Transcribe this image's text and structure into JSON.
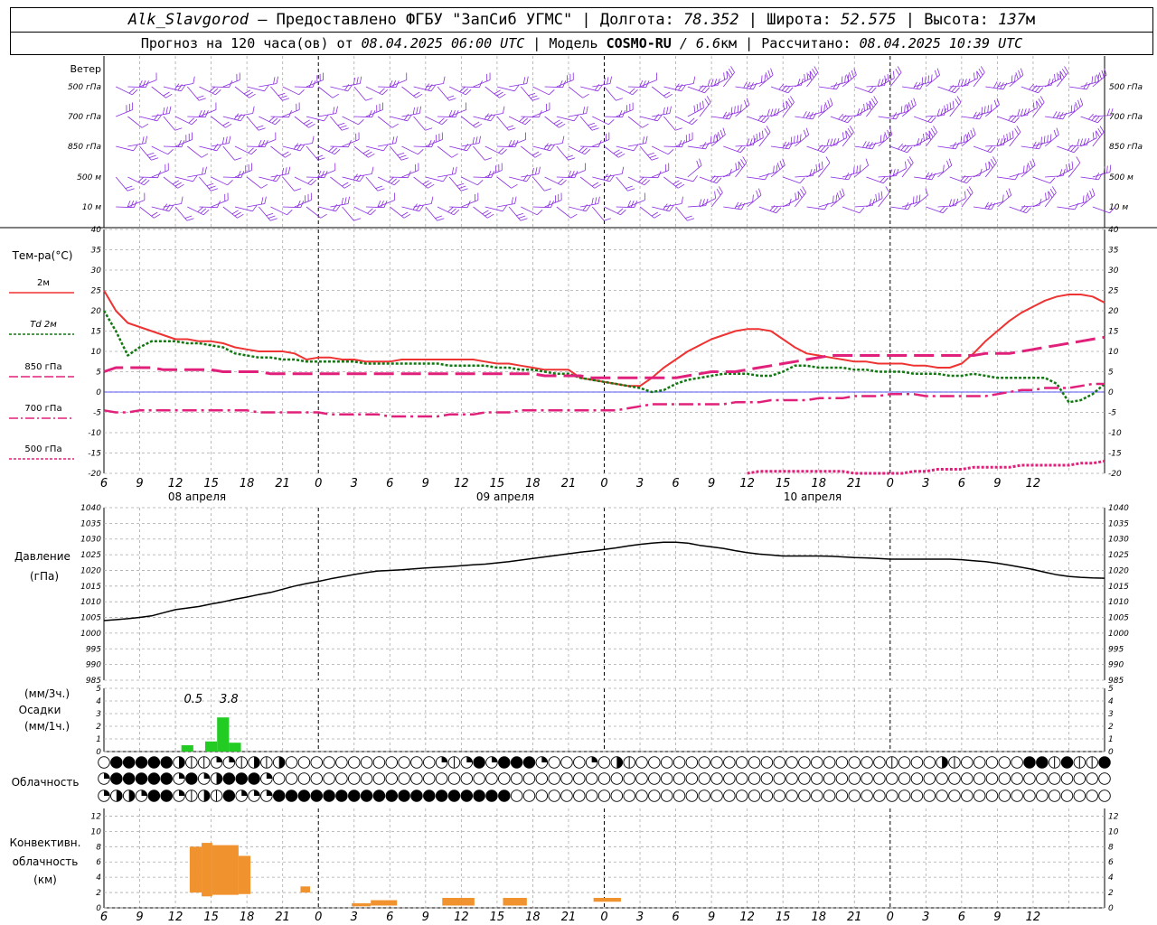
{
  "header": {
    "station": "Alk_Slavgorod",
    "provider": "— Предоставлено ФГБУ \"ЗапСиб УГМС\"",
    "lon_label": "Долгота:",
    "lon_value": "78.352",
    "lat_label": "Широта:",
    "lat_value": "52.575",
    "alt_label": "Высота:",
    "alt_value": "137",
    "alt_unit": "м",
    "forecast_label": "Прогноз на 120 часа(ов) от",
    "forecast_start": "08.04.2025 06:00 UTC",
    "model_label": "Модель",
    "model_name": "COSMO-RU",
    "model_res": "/ 6.6",
    "model_res_unit": "км",
    "computed_label": "Рассчитано:",
    "computed_value": "08.04.2025 10:39 UTC"
  },
  "colors": {
    "t2m": "#ee3333",
    "td2m": "#117711",
    "t850": "#e0207a",
    "t700": "#e0207a",
    "t500": "#e0207a",
    "wind": "#8a2be2",
    "precip": "#22cc22",
    "conv": "#f0922e",
    "pressure": "#000000",
    "zero_line": "#2222ee"
  },
  "chart_data": {
    "time_axis": {
      "hour_labels": [
        "6",
        "9",
        "12",
        "15",
        "18",
        "21",
        "0",
        "3",
        "6",
        "9",
        "12",
        "15",
        "18",
        "21",
        "0",
        "3",
        "6",
        "9",
        "12",
        "15",
        "18",
        "21",
        "0",
        "3",
        "6",
        "9",
        "12"
      ],
      "day_labels": [
        "08 апреля",
        "09 апреля",
        "10 апреля"
      ]
    },
    "wind": {
      "label": "Ветер",
      "levels": [
        "500 гПа",
        "700 гПа",
        "850 гПа",
        "500 м",
        "10 м"
      ]
    },
    "temperature": {
      "type": "line",
      "label": "Тем-ра(°C)",
      "ylim": [
        -20,
        40
      ],
      "ticks": [
        40,
        35,
        30,
        25,
        20,
        15,
        10,
        5,
        0,
        -5,
        -10,
        -15,
        -20
      ],
      "series": [
        {
          "name": "2м",
          "key": "t2m",
          "style": "solid",
          "values": [
            25,
            20,
            17,
            16,
            15,
            14,
            13,
            13,
            12.5,
            12.5,
            12,
            11,
            10.5,
            10,
            10,
            10,
            9.5,
            8,
            8.5,
            8.5,
            8,
            8,
            7.5,
            7.5,
            7.5,
            8,
            8,
            8,
            8,
            8,
            8,
            8,
            7.5,
            7,
            7,
            6.5,
            6,
            5.5,
            5.5,
            5.5,
            3.5,
            3,
            2.5,
            2,
            1.5,
            1.5,
            3.5,
            6,
            8,
            10,
            11.5,
            13,
            14,
            15,
            15.5,
            15.5,
            15,
            13,
            11,
            9.5,
            9,
            8.5,
            8,
            7.5,
            7.5,
            7,
            7,
            7,
            6.5,
            6.5,
            6,
            6,
            7,
            9.5,
            12.5,
            15,
            17.5,
            19.5,
            21,
            22.5,
            23.5,
            24,
            24,
            23.5,
            22
          ]
        },
        {
          "name": "Td 2м",
          "key": "td2m",
          "style": "dotted",
          "values": [
            20,
            15,
            9,
            11,
            12.5,
            12.5,
            12.5,
            12,
            12,
            11.5,
            11,
            9.5,
            9,
            8.5,
            8.5,
            8,
            8,
            7.5,
            7.5,
            7.5,
            7.5,
            7.5,
            7,
            7,
            7,
            7,
            7,
            7,
            7,
            6.5,
            6.5,
            6.5,
            6.5,
            6,
            6,
            5.5,
            5.5,
            5,
            4.5,
            4.5,
            3.5,
            3,
            2.5,
            2,
            1.5,
            1,
            0,
            0.5,
            2,
            3,
            3.5,
            4,
            4.5,
            4.5,
            4.5,
            4,
            4,
            5,
            6.5,
            6.5,
            6,
            6,
            6,
            5.5,
            5.5,
            5,
            5,
            5,
            4.5,
            4.5,
            4.5,
            4,
            4,
            4.5,
            4,
            3.5,
            3.5,
            3.5,
            3.5,
            3.5,
            2,
            -2.5,
            -2,
            -0.5,
            2
          ]
        },
        {
          "name": "850 гПа",
          "key": "t850",
          "style": "longdash",
          "values": [
            5,
            6,
            6,
            6,
            6,
            5.5,
            5.5,
            5.5,
            5.5,
            5.5,
            5,
            5,
            5,
            5,
            4.5,
            4.5,
            4.5,
            4.5,
            4.5,
            4.5,
            4.5,
            4.5,
            4.5,
            4.5,
            4.5,
            4.5,
            4.5,
            4.5,
            4.5,
            4.5,
            4.5,
            4.5,
            4.5,
            4.5,
            4.5,
            4.5,
            4.5,
            4,
            4,
            4,
            4,
            3.5,
            3.5,
            3.5,
            3.5,
            3.5,
            3.5,
            3.5,
            3.5,
            4,
            4.5,
            5,
            5,
            5,
            5.5,
            6,
            6.5,
            7,
            7.5,
            8,
            8.5,
            9,
            9,
            9,
            9,
            9,
            9,
            9,
            9,
            9,
            9,
            9,
            9,
            9,
            9.5,
            9.5,
            9.5,
            10,
            10.5,
            11,
            11.5,
            12,
            12.5,
            13,
            13.5
          ]
        },
        {
          "name": "700 гПа",
          "key": "t700",
          "style": "dashdot",
          "values": [
            -4.5,
            -5,
            -5,
            -4.5,
            -4.5,
            -4.5,
            -4.5,
            -4.5,
            -4.5,
            -4.5,
            -4.5,
            -4.5,
            -4.5,
            -5,
            -5,
            -5,
            -5,
            -5,
            -5,
            -5.5,
            -5.5,
            -5.5,
            -5.5,
            -5.5,
            -6,
            -6,
            -6,
            -6,
            -6,
            -5.5,
            -5.5,
            -5.5,
            -5,
            -5,
            -5,
            -4.5,
            -4.5,
            -4.5,
            -4.5,
            -4.5,
            -4.5,
            -4.5,
            -4.5,
            -4.5,
            -4,
            -3.5,
            -3,
            -3,
            -3,
            -3,
            -3,
            -3,
            -3,
            -2.5,
            -2.5,
            -2.5,
            -2,
            -2,
            -2,
            -2,
            -1.5,
            -1.5,
            -1.5,
            -1,
            -1,
            -1,
            -0.5,
            -0.5,
            -0.5,
            -1,
            -1,
            -1,
            -1,
            -1,
            -1,
            -0.5,
            0,
            0.5,
            0.5,
            1,
            1,
            1,
            1.5,
            2,
            2
          ]
        },
        {
          "name": "500 гПа",
          "key": "t500",
          "style": "fine",
          "values": [
            null,
            null,
            null,
            null,
            null,
            null,
            null,
            null,
            null,
            null,
            null,
            null,
            null,
            null,
            null,
            null,
            null,
            null,
            null,
            null,
            null,
            null,
            null,
            null,
            null,
            null,
            null,
            null,
            null,
            null,
            null,
            null,
            null,
            null,
            null,
            null,
            null,
            null,
            null,
            null,
            null,
            null,
            null,
            null,
            null,
            null,
            null,
            null,
            null,
            null,
            null,
            null,
            null,
            null,
            -20,
            -19.5,
            -19.5,
            -19.5,
            -19.5,
            -19.5,
            -19.5,
            -19.5,
            -19.5,
            -20,
            -20,
            -20,
            -20,
            -20,
            -19.5,
            -19.5,
            -19,
            -19,
            -19,
            -18.5,
            -18.5,
            -18.5,
            -18.5,
            -18,
            -18,
            -18,
            -18,
            -18,
            -17.5,
            -17.5,
            -17
          ]
        }
      ]
    },
    "pressure": {
      "type": "line",
      "label": "Давление",
      "unit": "(гПа)",
      "ylim": [
        985,
        1040
      ],
      "ticks": [
        1040,
        1035,
        1030,
        1025,
        1020,
        1015,
        1010,
        1005,
        1000,
        995,
        990,
        985
      ],
      "values": [
        1004,
        1004.3,
        1004.6,
        1005,
        1005.5,
        1006.5,
        1007.5,
        1008,
        1008.5,
        1009.3,
        1010,
        1010.8,
        1011.5,
        1012.3,
        1013,
        1014,
        1015,
        1015.8,
        1016.5,
        1017.3,
        1018,
        1018.7,
        1019.3,
        1019.8,
        1020,
        1020.2,
        1020.5,
        1020.8,
        1021,
        1021.2,
        1021.5,
        1021.8,
        1022,
        1022.4,
        1022.8,
        1023.3,
        1023.8,
        1024.3,
        1024.8,
        1025.3,
        1025.8,
        1026.2,
        1026.7,
        1027.2,
        1027.8,
        1028.3,
        1028.7,
        1029,
        1029,
        1028.7,
        1028,
        1027.5,
        1027,
        1026.3,
        1025.7,
        1025.2,
        1024.9,
        1024.6,
        1024.6,
        1024.6,
        1024.6,
        1024.5,
        1024.3,
        1024.1,
        1024,
        1023.8,
        1023.6,
        1023.6,
        1023.6,
        1023.6,
        1023.6,
        1023.6,
        1023.4,
        1023.1,
        1022.8,
        1022.3,
        1021.7,
        1021,
        1020.3,
        1019.4,
        1018.6,
        1018.1,
        1017.8,
        1017.6,
        1017.5
      ]
    },
    "precip": {
      "type": "bar",
      "label_unit_1": "(мм/3ч.)",
      "label": "Осадки",
      "label_unit_2": "(мм/1ч.)",
      "ylim": [
        0,
        5
      ],
      "ticks": [
        5,
        4,
        3,
        2,
        1,
        0
      ],
      "totals_3h": [
        {
          "h": 7.5,
          "text": "0.5"
        },
        {
          "h": 10.5,
          "text": "3.8"
        }
      ],
      "hourly": [
        {
          "h": 7,
          "v": 0.5
        },
        {
          "h": 9,
          "v": 0.8
        },
        {
          "h": 10,
          "v": 2.7
        },
        {
          "h": 11,
          "v": 0.7
        }
      ]
    },
    "clouds": {
      "label": "Облачность",
      "rows": [
        "0222223441143430000000000001412122210001034000000000000000000004000340000022424424020004402222122222202",
        "1222221213222100000000000000000000000000000000000000000000000000000000000000000000000000000000000000000",
        "1331221434211122222222222222222220000000000000000000000000000000000000000000000000000000000000000000000"
      ]
    },
    "convective": {
      "type": "bar",
      "label_1": "Конвективн.",
      "label_2": "облачность",
      "label_3": "(км)",
      "ylim": [
        0,
        13
      ],
      "ticks": [
        12,
        10,
        8,
        6,
        4,
        2,
        0
      ],
      "layers": [
        {
          "h0": 7.2,
          "h1": 8.2,
          "base": 2,
          "top": 8
        },
        {
          "h0": 8.2,
          "h1": 9.1,
          "base": 1.5,
          "top": 8.5
        },
        {
          "h0": 9.1,
          "h1": 11.3,
          "base": 1.7,
          "top": 8.2
        },
        {
          "h0": 11.3,
          "h1": 12.3,
          "base": 1.8,
          "top": 6.8
        },
        {
          "h0": 16.5,
          "h1": 17.3,
          "base": 2,
          "top": 2.8
        },
        {
          "h0": 20.8,
          "h1": 22.4,
          "base": 0.2,
          "top": 0.6
        },
        {
          "h0": 22.4,
          "h1": 24.6,
          "base": 0.3,
          "top": 1
        },
        {
          "h0": 28.4,
          "h1": 31.1,
          "base": 0.3,
          "top": 1.3
        },
        {
          "h0": 33.5,
          "h1": 35.5,
          "base": 0.3,
          "top": 1.3
        },
        {
          "h0": 41.1,
          "h1": 43.4,
          "base": 0.8,
          "top": 1.3
        }
      ]
    }
  }
}
